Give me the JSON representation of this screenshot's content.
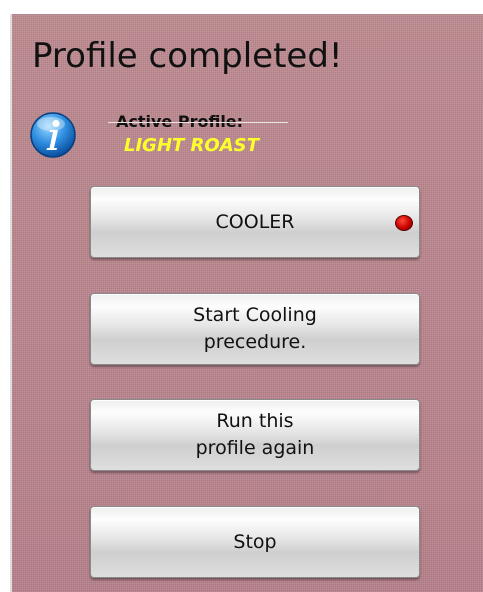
{
  "header": {
    "title": "Profile completed!"
  },
  "profile": {
    "active_label": "Active Profile:",
    "name": "LIGHT ROAST",
    "name_color": "#ffff2a"
  },
  "buttons": {
    "cooler": {
      "label": "COOLER",
      "indicator_color": "#cc0000",
      "indicator": "red-led-icon"
    },
    "start_cooling": {
      "label": "Start Cooling\nprecedure."
    },
    "run_again": {
      "label": "Run this\nprofile again"
    },
    "stop": {
      "label": "Stop"
    }
  },
  "icons": {
    "info": "info-icon"
  },
  "colors": {
    "panel_background": "#b98289"
  }
}
